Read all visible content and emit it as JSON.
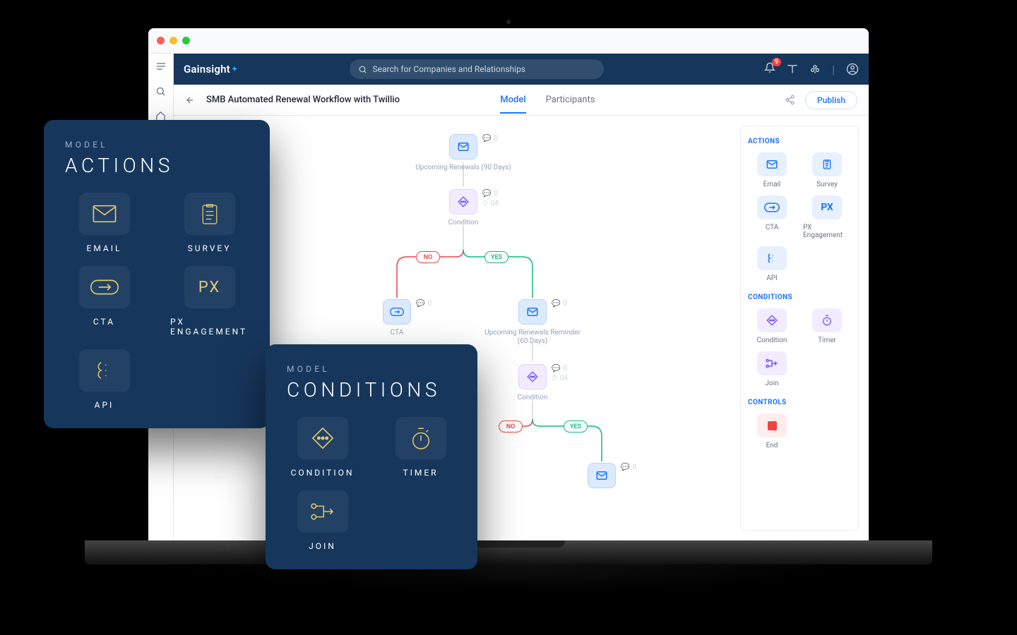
{
  "browser": {
    "traffic_colors": [
      "#ff5f57",
      "#febc2e",
      "#28c840"
    ]
  },
  "header": {
    "brand": "Gainsight",
    "search_placeholder": "Search for Companies and Relationships",
    "notification_count": "9"
  },
  "toolbar": {
    "title": "SMB Automated Renewal Workflow with Twillio",
    "tabs": {
      "model": "Model",
      "participants": "Participants"
    },
    "publish_label": "Publish"
  },
  "right_panel": {
    "section_actions": "ACTIONS",
    "section_conditions": "CONDITIONS",
    "section_controls": "CONTROLS",
    "actions": {
      "email": "Email",
      "survey": "Survey",
      "cta": "CTA",
      "px": "PX Engagement",
      "api": "API"
    },
    "conditions": {
      "condition": "Condition",
      "timer": "Timer",
      "join": "Join"
    },
    "controls": {
      "end": "End"
    }
  },
  "flow": {
    "n1": {
      "label": "Upcoming Renewals (90 Days)",
      "m1": "0"
    },
    "n2": {
      "label": "Condition",
      "m1": "0",
      "m2": "04"
    },
    "n3": {
      "label": "CTA",
      "m1": "0"
    },
    "n4": {
      "label": "Upcoming Renewals Reminder (60 Days)",
      "m1": "0"
    },
    "n5": {
      "label": "Condition",
      "m1": "0",
      "m2": "04"
    },
    "n6": {
      "m1": "0"
    },
    "yes": "YES",
    "no": "NO"
  },
  "overlay_actions": {
    "eyebrow": "MODEL",
    "title": "ACTIONS",
    "email": "EMAIL",
    "survey": "SURVEY",
    "cta": "CTA",
    "px": "PX ENGAGEMENT",
    "api": "API"
  },
  "overlay_conditions": {
    "eyebrow": "MODEL",
    "title": "CONDITIONS",
    "condition": "CONDITION",
    "timer": "TIMER",
    "join": "JOIN"
  }
}
